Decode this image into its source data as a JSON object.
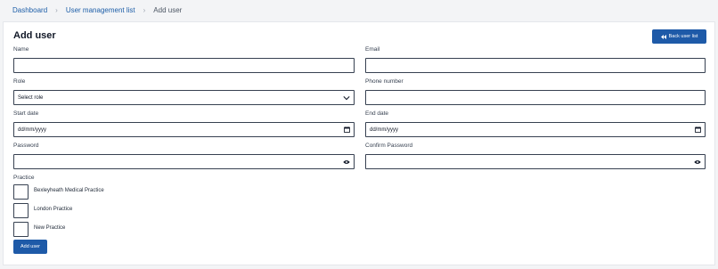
{
  "breadcrumb": {
    "items": [
      "Dashboard",
      "User management list"
    ],
    "separator": "›",
    "current": "Add user"
  },
  "form": {
    "title": "Add user",
    "back_button_label": "Back user list",
    "name_label": "Name",
    "email_label": "Email",
    "role_label": "Role",
    "role_selected": "Select role",
    "phone_label": "Phone number",
    "start_date_label": "Start date",
    "start_date_value": "dd/mm/yyyy",
    "end_date_label": "End date",
    "end_date_value": "dd/mm/yyyy",
    "password_label": "Password",
    "confirm_password_label": "Confirm Password",
    "practice_label": "Practice",
    "practices": [
      "Bexleyheath Medical Practice",
      "London Practice",
      "New Practice"
    ],
    "submit_label": "Add user"
  },
  "colors": {
    "primary": "#1e5aa8",
    "link": "#1d5ea8",
    "border": "#374151"
  },
  "icons": {
    "back": "double-chevron-left-icon",
    "dropdown": "chevron-down-icon",
    "calendar": "calendar-icon",
    "visibility": "eye-icon"
  }
}
